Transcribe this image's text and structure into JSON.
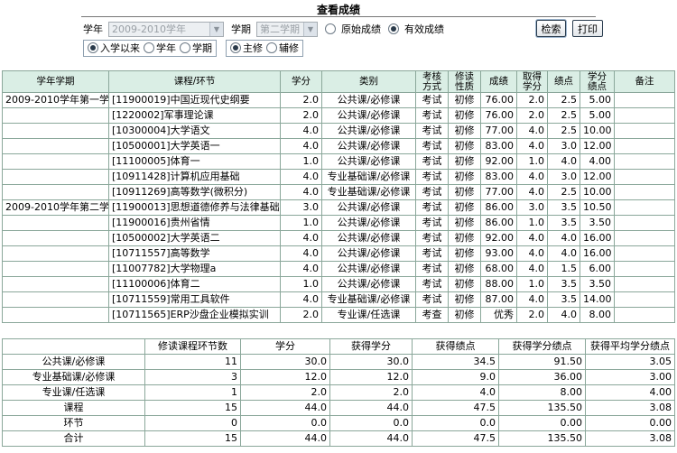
{
  "page": {
    "title": "查看成绩"
  },
  "filters": {
    "year_label": "学年",
    "year_value": "2009-2010学年",
    "term_label": "学期",
    "term_value": "第二学期",
    "radio_original": "原始成绩",
    "radio_valid": "有效成绩",
    "radio_since_entry": "入学以来",
    "radio_year": "学年",
    "radio_term": "学期",
    "radio_major": "主修",
    "radio_minor": "辅修"
  },
  "buttons": {
    "search": "检索",
    "print": "打印"
  },
  "grades": {
    "headers": {
      "year_term": "学年学期",
      "course": "课程/环节",
      "credit": "学分",
      "category": "类别",
      "exam_1": "考核",
      "exam_2": "方式",
      "study_1": "修读",
      "study_2": "性质",
      "score": "成绩",
      "earned_1": "取得",
      "earned_2": "学分",
      "gpa": "绩点",
      "cgpa_1": "学分",
      "cgpa_2": "绩点",
      "remark": "备注"
    },
    "rows": [
      {
        "term": "2009-2010学年第一学期",
        "course": "[11900019]中国近现代史纲要",
        "credit": "2.0",
        "category": "公共课/必修课",
        "exam": "考试",
        "study": "初修",
        "score": "76.00",
        "earned": "2.0",
        "gp": "2.5",
        "cgp": "5.00",
        "remark": ""
      },
      {
        "term": "",
        "course": "[1220002]军事理论课",
        "credit": "2.0",
        "category": "公共课/必修课",
        "exam": "考试",
        "study": "初修",
        "score": "76.00",
        "earned": "2.0",
        "gp": "2.5",
        "cgp": "5.00",
        "remark": ""
      },
      {
        "term": "",
        "course": "[10300004]大学语文",
        "credit": "4.0",
        "category": "公共课/必修课",
        "exam": "考试",
        "study": "初修",
        "score": "77.00",
        "earned": "4.0",
        "gp": "2.5",
        "cgp": "10.00",
        "remark": ""
      },
      {
        "term": "",
        "course": "[10500001]大学英语一",
        "credit": "4.0",
        "category": "公共课/必修课",
        "exam": "考试",
        "study": "初修",
        "score": "83.00",
        "earned": "4.0",
        "gp": "3.0",
        "cgp": "12.00",
        "remark": ""
      },
      {
        "term": "",
        "course": "[11100005]体育一",
        "credit": "1.0",
        "category": "公共课/必修课",
        "exam": "考试",
        "study": "初修",
        "score": "92.00",
        "earned": "1.0",
        "gp": "4.0",
        "cgp": "4.00",
        "remark": ""
      },
      {
        "term": "",
        "course": "[10911428]计算机应用基础",
        "credit": "4.0",
        "category": "专业基础课/必修课",
        "exam": "考试",
        "study": "初修",
        "score": "83.00",
        "earned": "4.0",
        "gp": "3.0",
        "cgp": "12.00",
        "remark": ""
      },
      {
        "term": "",
        "course": "[10911269]高等数学(微积分)",
        "credit": "4.0",
        "category": "专业基础课/必修课",
        "exam": "考试",
        "study": "初修",
        "score": "77.00",
        "earned": "4.0",
        "gp": "2.5",
        "cgp": "10.00",
        "remark": ""
      },
      {
        "term": "2009-2010学年第二学期",
        "course": "[11900013]思想道德修养与法律基础",
        "credit": "3.0",
        "category": "公共课/必修课",
        "exam": "考试",
        "study": "初修",
        "score": "86.00",
        "earned": "3.0",
        "gp": "3.5",
        "cgp": "10.50",
        "remark": ""
      },
      {
        "term": "",
        "course": "[11900016]贵州省情",
        "credit": "1.0",
        "category": "公共课/必修课",
        "exam": "考试",
        "study": "初修",
        "score": "86.00",
        "earned": "1.0",
        "gp": "3.5",
        "cgp": "3.50",
        "remark": ""
      },
      {
        "term": "",
        "course": "[10500002]大学英语二",
        "credit": "4.0",
        "category": "公共课/必修课",
        "exam": "考试",
        "study": "初修",
        "score": "92.00",
        "earned": "4.0",
        "gp": "4.0",
        "cgp": "16.00",
        "remark": ""
      },
      {
        "term": "",
        "course": "[10711557]高等数学",
        "credit": "4.0",
        "category": "公共课/必修课",
        "exam": "考试",
        "study": "初修",
        "score": "93.00",
        "earned": "4.0",
        "gp": "4.0",
        "cgp": "16.00",
        "remark": ""
      },
      {
        "term": "",
        "course": "[11007782]大学物理a",
        "credit": "4.0",
        "category": "公共课/必修课",
        "exam": "考试",
        "study": "初修",
        "score": "68.00",
        "earned": "4.0",
        "gp": "1.5",
        "cgp": "6.00",
        "remark": ""
      },
      {
        "term": "",
        "course": "[11100006]体育二",
        "credit": "1.0",
        "category": "公共课/必修课",
        "exam": "考试",
        "study": "初修",
        "score": "88.00",
        "earned": "1.0",
        "gp": "3.5",
        "cgp": "3.50",
        "remark": ""
      },
      {
        "term": "",
        "course": "[10711559]常用工具软件",
        "credit": "4.0",
        "category": "专业基础课/必修课",
        "exam": "考试",
        "study": "初修",
        "score": "87.00",
        "earned": "4.0",
        "gp": "3.5",
        "cgp": "14.00",
        "remark": ""
      },
      {
        "term": "",
        "course": "[10711565]ERP沙盘企业模拟实训",
        "credit": "2.0",
        "category": "专业课/任选课",
        "exam": "考查",
        "study": "初修",
        "score": "优秀",
        "earned": "2.0",
        "gp": "4.0",
        "cgp": "8.00",
        "remark": ""
      }
    ]
  },
  "summary": {
    "headers": {
      "blank": "",
      "count": "修读课程环节数",
      "credit": "学分",
      "earned": "获得学分",
      "gp": "获得绩点",
      "cgp": "获得学分绩点",
      "avg": "获得平均学分绩点"
    },
    "rows": [
      {
        "name": "公共课/必修课",
        "count": "11",
        "credit": "30.0",
        "earned": "30.0",
        "gp": "34.5",
        "cgp": "91.50",
        "avg": "3.05"
      },
      {
        "name": "专业基础课/必修课",
        "count": "3",
        "credit": "12.0",
        "earned": "12.0",
        "gp": "9.0",
        "cgp": "36.00",
        "avg": "3.00"
      },
      {
        "name": "专业课/任选课",
        "count": "1",
        "credit": "2.0",
        "earned": "2.0",
        "gp": "4.0",
        "cgp": "8.00",
        "avg": "4.00"
      },
      {
        "name": "课程",
        "count": "15",
        "credit": "44.0",
        "earned": "44.0",
        "gp": "47.5",
        "cgp": "135.50",
        "avg": "3.08"
      },
      {
        "name": "环节",
        "count": "0",
        "credit": "0.0",
        "earned": "0.0",
        "gp": "0.0",
        "cgp": "0.00",
        "avg": "0.00"
      },
      {
        "name": "合计",
        "count": "15",
        "credit": "44.0",
        "earned": "44.0",
        "gp": "47.5",
        "cgp": "135.50",
        "avg": "3.08"
      }
    ]
  }
}
